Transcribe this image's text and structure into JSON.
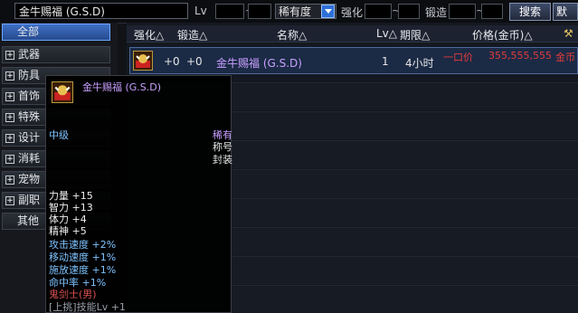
{
  "colors": {
    "accent": "#2d6fd6",
    "item_name": "#c9a0ff",
    "price": "#e23b3b",
    "green_stat": "#7ec3ff",
    "gold": "#d8b24a"
  },
  "search": {
    "value": "金牛赐福 (G.S.D)",
    "lv_label": "Lv",
    "tilde": "~",
    "rarity": "稀有度",
    "enhance_label": "强化",
    "forge_label": "锻造",
    "search_button": "搜索",
    "default_button": "默认"
  },
  "sidebar": {
    "items": [
      {
        "label": "全部",
        "selected": true
      },
      {
        "label": "武器"
      },
      {
        "label": "防具"
      },
      {
        "label": "首饰"
      },
      {
        "label": "特殊"
      },
      {
        "label": "设计"
      },
      {
        "label": "消耗"
      },
      {
        "label": "宠物"
      },
      {
        "label": "副职"
      },
      {
        "label": "其他"
      }
    ]
  },
  "table": {
    "headers": {
      "enhance": "强化△",
      "forge": "锻造△",
      "name": "名称△",
      "lv": "Lv△",
      "limit": "期限△",
      "price": "价格(金币)△",
      "hammer_icon": "hammer-icon"
    },
    "row": {
      "enhance": "+0",
      "forge": "+0",
      "name": "金牛赐福 (G.S.D)",
      "lv": "1",
      "limit": "4小时",
      "price_type": "一口价",
      "price": "355,555,555",
      "currency": "金币"
    }
  },
  "tooltip": {
    "name": "金牛赐福 (G.S.D)",
    "grade": "中级",
    "rarity": "稀有",
    "type": "称号",
    "bind": "封装",
    "stats": [
      "力量 +15",
      "智力 +13",
      "体力 +4",
      "精神 +5"
    ],
    "bonus": [
      "攻击速度 +2%",
      "移动速度 +1%",
      "施放速度 +1%",
      "命中率 +1%"
    ],
    "class_req": "鬼剑士(男)",
    "skill": "[上挑]技能Lv +1"
  }
}
